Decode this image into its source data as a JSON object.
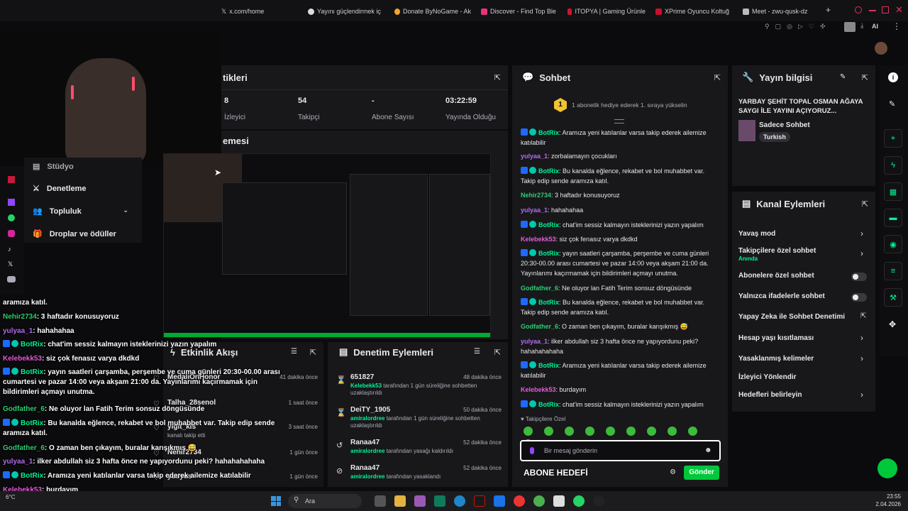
{
  "browser": {
    "tabs": [
      "x.com/home",
      "Yayını güçlendirmek iç",
      "Donate ByNoGame - Ak",
      "Discover - Find Top Ble",
      "ITOPYA | Gaming Ürünle",
      "XPrime Oyuncu Koltuğ",
      "Meet - zwu-qusk-dz"
    ],
    "new_tab": "+",
    "ai_label": "AI"
  },
  "stats_panel": {
    "title_partial": "tikleri",
    "items": [
      {
        "value": "8",
        "label": "İzleyici"
      },
      {
        "value": "54",
        "label": "Takipçi"
      },
      {
        "value": "-",
        "label": "Abone Sayısı"
      },
      {
        "value": "03:22:59",
        "label": "Yayında Olduğu Süre"
      }
    ]
  },
  "preview": {
    "title_partial": "emesi"
  },
  "left_menu": {
    "items": [
      "Stüdyo",
      "Denetleme",
      "Topluluk",
      "Droplar ve ödüller"
    ]
  },
  "chat": {
    "title": "Sohbet",
    "gift_text": "1 abonelik hediye ederek 1. sıraya yükselin",
    "gift_rank": "1",
    "messages": [
      {
        "user": "BotRix",
        "text": ": Aramıza yeni katılanlar varsa takip ederek ailemize katılabilir",
        "color": "#00f593",
        "bot": true
      },
      {
        "user": "yulyaa_1",
        "text": ": zorbalamayın çocukları",
        "color": "#b36bf0",
        "bot": false
      },
      {
        "user": "BotRix",
        "text": ": Bu kanalda eğlence, rekabet ve bol muhabbet var. Takip edip sende aramıza katıl.",
        "color": "#00f593",
        "bot": true
      },
      {
        "user": "Nehir2734",
        "text": ": 3 haftadır konusuyoruz",
        "color": "#2ecc71",
        "bot": false
      },
      {
        "user": "yulyaa_1",
        "text": ": hahahahaa",
        "color": "#b36bf0",
        "bot": false
      },
      {
        "user": "BotRix",
        "text": ": chat'im sessiz kalmayın isteklerinizi yazın yapalım",
        "color": "#00f593",
        "bot": true
      },
      {
        "user": "Kelebekk53",
        "text": ": siz çok fenasız varya dkdkd",
        "color": "#e45dd8",
        "bot": false
      },
      {
        "user": "BotRix",
        "text": ": yayın saatleri çarşamba, perşembe ve cuma günleri 20:30-00.00 arası cumartesi ve pazar 14:00 veya akşam 21:00 da. Yayınlarımı kaçırmamak için bildirimleri açmayı unutma.",
        "color": "#00f593",
        "bot": true
      },
      {
        "user": "Godfather_6",
        "text": ": Ne oluyor lan Fatih Terim sonsuz döngüsünde",
        "color": "#2ecc71",
        "bot": false
      },
      {
        "user": "BotRix",
        "text": ": Bu kanalda eğlence, rekabet ve bol muhabbet var. Takip edip sende aramıza katıl.",
        "color": "#00f593",
        "bot": true
      },
      {
        "user": "Godfather_6",
        "text": ": O zaman ben çıkayım, buralar karışıkmış 😅",
        "color": "#2ecc71",
        "bot": false
      },
      {
        "user": "yulyaa_1",
        "text": ": ilker abdullah siz 3 hafta önce ne yapıyordunu peki? hahahahahaha",
        "color": "#b36bf0",
        "bot": false
      },
      {
        "user": "BotRix",
        "text": ": Aramıza yeni katılanlar varsa takip ederek ailemize katılabilir",
        "color": "#00f593",
        "bot": true
      },
      {
        "user": "Kelebekk53",
        "text": ": burdayım",
        "color": "#e45dd8",
        "bot": false
      },
      {
        "user": "BotRix",
        "text": ": chat'im sessiz kalmayın isteklerinizi yazın yapalım",
        "color": "#00f593",
        "bot": true
      }
    ],
    "followers_only": "Takipçilere Özel",
    "input_placeholder": "Bir mesaj gönderin",
    "send_label": "Gönder",
    "bottom_text": "ABONE HEDEFİ"
  },
  "stream_info": {
    "title": "Yayın bilgisi",
    "stream_title": "YARBAY ŞEHİT TOPAL OSMAN AĞAYA SAYGI İLE YAYINI AÇIYORUZ...",
    "category": "Sadece Sohbet",
    "tag": "Turkish"
  },
  "channel_actions": {
    "title": "Kanal Eylemleri",
    "items": [
      {
        "label": "Yavaş mod",
        "sub": "",
        "control": "chevron"
      },
      {
        "label": "Takipçilere özel sohbet",
        "sub": "Anında",
        "control": "chevron"
      },
      {
        "label": "Abonelere özel sohbet",
        "sub": "",
        "control": "toggle"
      },
      {
        "label": "Yalnızca ifadelerle sohbet",
        "sub": "",
        "control": "toggle"
      },
      {
        "label": "Yapay Zeka ile Sohbet Denetimi",
        "sub": "",
        "control": "link"
      },
      {
        "label": "Hesap yaşı kısıtlaması",
        "sub": "",
        "control": "chevron"
      },
      {
        "label": "Yasaklanmış kelimeler",
        "sub": "",
        "control": "chevron"
      },
      {
        "label": "İzleyici Yönlendir",
        "sub": "",
        "control": "none"
      },
      {
        "label": "Hedefleri belirleyin",
        "sub": "",
        "control": "chevron"
      }
    ]
  },
  "activity": {
    "title": "Etkinlik Akışı",
    "items": [
      {
        "name": "MedaliOnHonor",
        "sub": "",
        "time": "41 dakika önce"
      },
      {
        "name": "Talha_28senol",
        "sub": "",
        "time": "1 saat önce"
      },
      {
        "name": "yigit_kis",
        "sub": "kanalı takip etti",
        "time": "3 saat önce"
      },
      {
        "name": "Nehir2734",
        "sub": "",
        "time": "1 gün önce"
      },
      {
        "name": "yusyus",
        "sub": "",
        "time": "1 gün önce"
      }
    ]
  },
  "moderation": {
    "title": "Denetim Eylemleri",
    "items": [
      {
        "target": "651827",
        "actor": "Kelebekk53",
        "desc": "tarafından 1 gün süreliğine sohbetten uzaklaştırıldı",
        "time": "48 dakika önce"
      },
      {
        "target": "DeiTY_1905",
        "actor": "amiralordree",
        "desc": "tarafından 1 gün süreliğine sohbetten uzaklaştırıldı",
        "time": "50 dakika önce"
      },
      {
        "target": "Ranaa47",
        "actor": "amiralordree",
        "desc": "tarafından yasağı kaldırıldı",
        "time": "52 dakika önce"
      },
      {
        "target": "Ranaa47",
        "actor": "amiralordree",
        "desc": "tarafından yasaklandı",
        "time": "52 dakika önce"
      }
    ]
  },
  "overlay_chat": [
    {
      "user": "",
      "text": "aramıza katıl.",
      "color": "#fff",
      "bot": false
    },
    {
      "user": "Nehir2734",
      "text": ": 3 haftadır konusuyoruz",
      "color": "#2ecc71",
      "bot": false
    },
    {
      "user": "yulyaa_1",
      "text": ": hahahahaa",
      "color": "#b36bf0",
      "bot": false
    },
    {
      "user": "BotRix",
      "text": ": chat'im sessiz kalmayın isteklerinizi yazın yapalım",
      "color": "#00f593",
      "bot": true
    },
    {
      "user": "Kelebekk53",
      "text": ": siz çok fenasız varya dkdkd",
      "color": "#e45dd8",
      "bot": false
    },
    {
      "user": "BotRix",
      "text": ": yayın saatleri çarşamba, perşembe ve cuma günleri 20:30-00.00 arası cumartesi ve pazar 14:00 veya akşam 21:00 da. Yayınlarımı kaçırmamak için bildirimleri açmayı unutma.",
      "color": "#00f593",
      "bot": true
    },
    {
      "user": "Godfather_6",
      "text": ": Ne oluyor lan Fatih Terim sonsuz döngüsünde",
      "color": "#2ecc71",
      "bot": false
    },
    {
      "user": "BotRix",
      "text": ": Bu kanalda eğlence, rekabet ve bol muhabbet var. Takip edip sende aramıza katıl.",
      "color": "#00f593",
      "bot": true
    },
    {
      "user": "Godfather_6",
      "text": ": O zaman ben çıkayım, buralar karışıkmış 😅",
      "color": "#2ecc71",
      "bot": false
    },
    {
      "user": "yulyaa_1",
      "text": ": ilker abdullah siz 3 hafta önce ne yapıyordunu peki? hahahahahaha",
      "color": "#b36bf0",
      "bot": false
    },
    {
      "user": "BotRix",
      "text": ": Aramıza yeni katılanlar varsa takip ederek ailemize katılabilir",
      "color": "#00f593",
      "bot": true
    },
    {
      "user": "Kelebekk53",
      "text": ": burdayım",
      "color": "#e45dd8",
      "bot": false
    },
    {
      "user": "BotRix",
      "text": ": chat'im sessiz kalmayın isteklerinizi yazın yapalım",
      "color": "#00f593",
      "bot": true
    }
  ],
  "taskbar": {
    "search": "Ara",
    "weather": "6°C",
    "time": "23:55",
    "date": "2.04.2026"
  },
  "colors": {
    "accent": "#00f593",
    "bg": "#0e0e10",
    "panel": "#18181b"
  }
}
